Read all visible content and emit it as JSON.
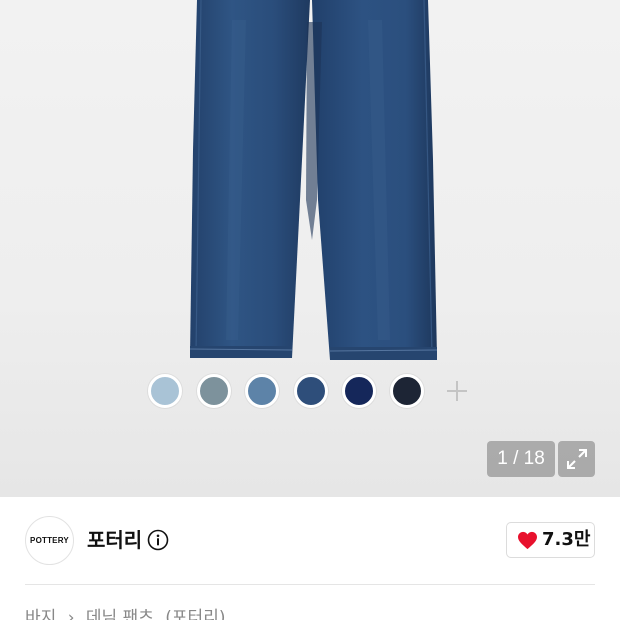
{
  "product_image": {
    "counter": "1 / 18",
    "swatches": [
      {
        "name": "light-blue",
        "color": "#a9c3d6"
      },
      {
        "name": "grey-blue",
        "color": "#7d929c"
      },
      {
        "name": "mid-blue",
        "color": "#5d83a8"
      },
      {
        "name": "denim-blue",
        "color": "#2e4e7a"
      },
      {
        "name": "navy",
        "color": "#15275a"
      },
      {
        "name": "dark-navy",
        "color": "#1d2535"
      }
    ],
    "more_swatches_icon": "plus-icon",
    "expand_icon": "expand-icon"
  },
  "brand": {
    "logo_text": "POTTERY",
    "name": "포터리",
    "info_icon": "info-icon"
  },
  "like": {
    "icon": "heart-icon",
    "count": "7.3만",
    "color": "#e8112d"
  },
  "breadcrumb": {
    "items": [
      "바지",
      "›",
      "데님 팬츠",
      "(포터리)"
    ]
  }
}
